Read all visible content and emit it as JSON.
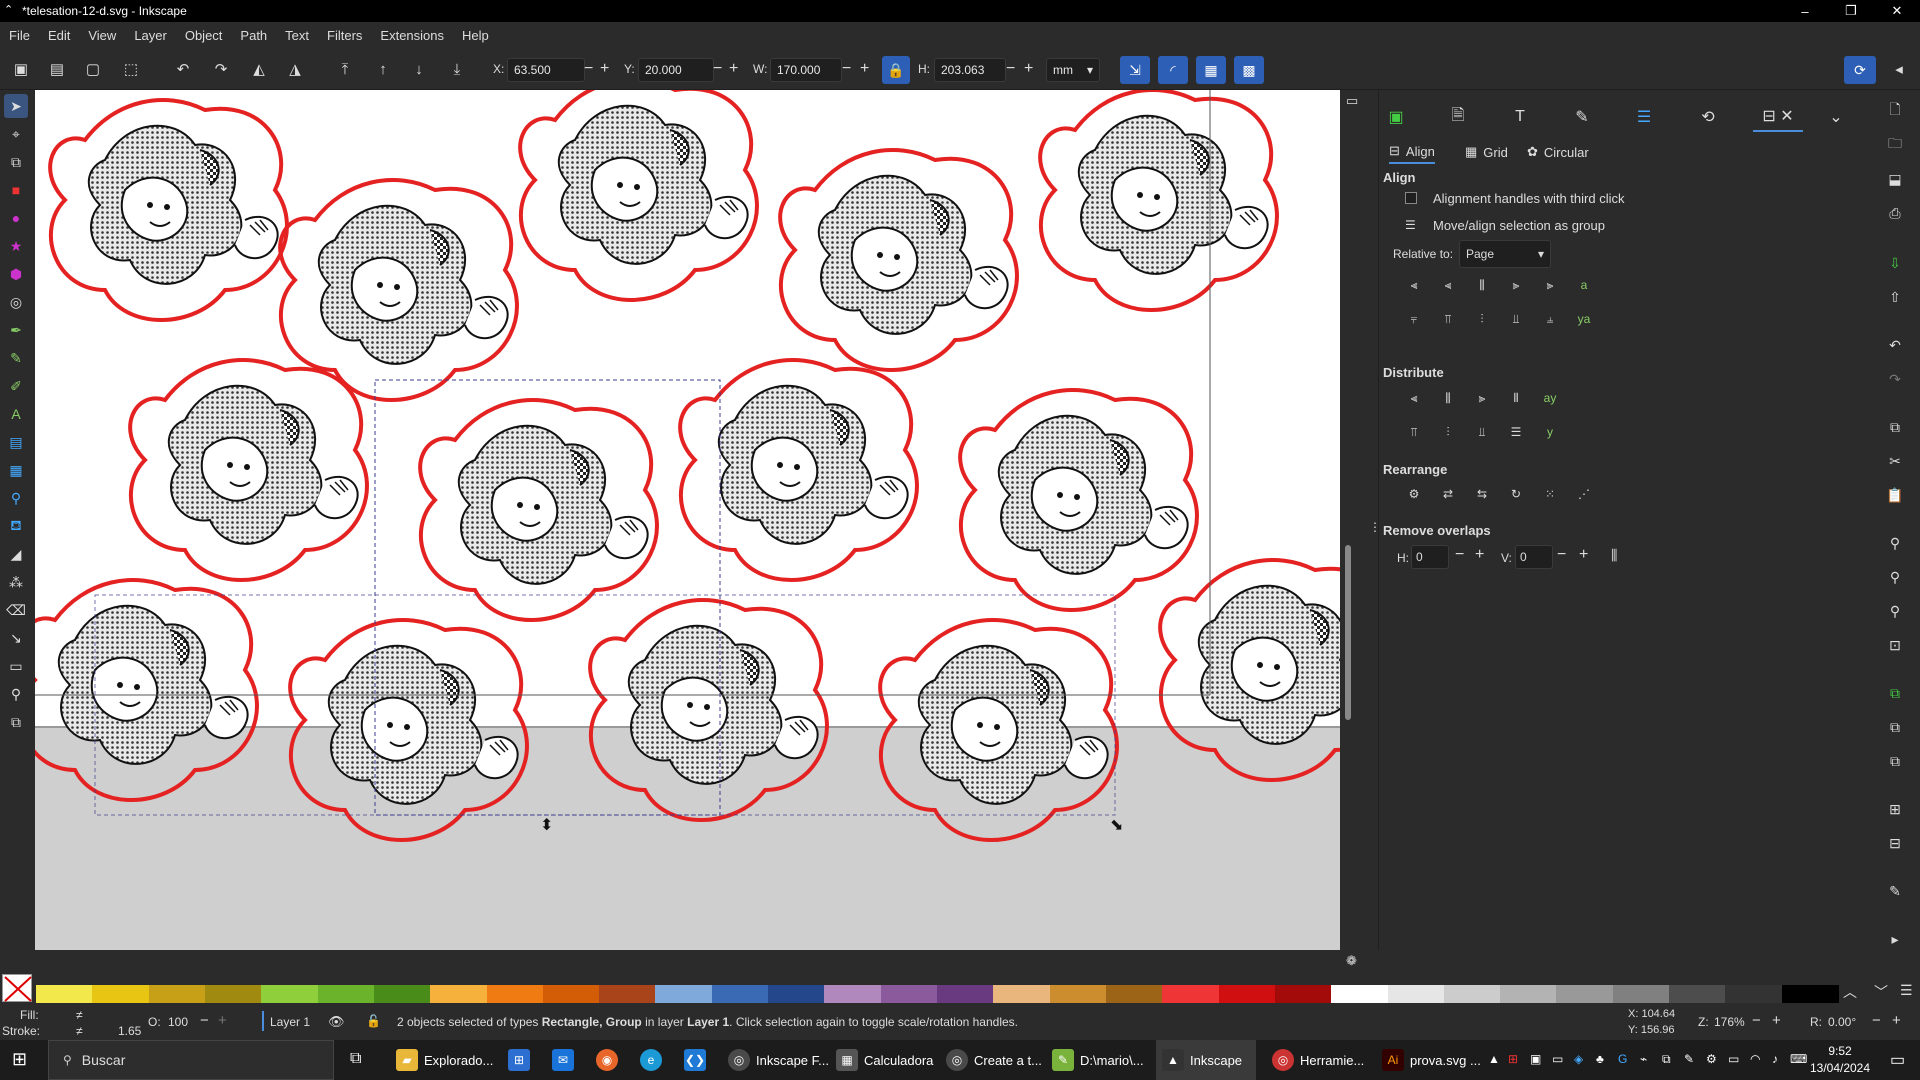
{
  "window": {
    "title": "*telesation-12-d.svg - Inkscape",
    "minimize": "–",
    "maximize": "❐",
    "close": "✕"
  },
  "menu": [
    "File",
    "Edit",
    "View",
    "Layer",
    "Object",
    "Path",
    "Text",
    "Filters",
    "Extensions",
    "Help"
  ],
  "toolbar": {
    "x_label": "X:",
    "x_value": "63.500",
    "y_label": "Y:",
    "y_value": "20.000",
    "w_label": "W:",
    "w_value": "170.000",
    "h_label": "H:",
    "h_value": "203.063",
    "unit": "mm"
  },
  "panel": {
    "subtabs": [
      "Align",
      "Grid",
      "Circular"
    ],
    "align_title": "Align",
    "opt_handles": "Alignment handles with third click",
    "opt_group": "Move/align selection as group",
    "relative_label": "Relative to:",
    "relative_value": "Page",
    "distribute_title": "Distribute",
    "rearrange_title": "Rearrange",
    "overlaps_title": "Remove overlaps",
    "h_label": "H:",
    "h_value": "0",
    "v_label": "V:",
    "v_value": "0"
  },
  "palette": {
    "colors": [
      "#f3e84b",
      "#e8c513",
      "#c7a017",
      "#a08a10",
      "#8fcf3c",
      "#6bb32a",
      "#4a8c1a",
      "#f6b13c",
      "#f07b13",
      "#d35c07",
      "#a8431a",
      "#7fa9db",
      "#3a6ab3",
      "#24478c",
      "#b088be",
      "#8a5a9c",
      "#6a3a80",
      "#e9b77d",
      "#cc8d2e",
      "#9b6416",
      "#ef3535",
      "#d01010",
      "#a30a0a",
      "#ffffff",
      "#e6e6e6",
      "#cccccc",
      "#b3b3b3",
      "#999999",
      "#808080",
      "#4d4d4d",
      "#333333",
      "#000000"
    ]
  },
  "status": {
    "fill_label": "Fill:",
    "fill_value": "≠",
    "stroke_label": "Stroke:",
    "stroke_value": "≠",
    "stroke_width": "1.65",
    "opacity_label": "O:",
    "opacity_value": "100",
    "layer": "Layer 1",
    "message_pre": "2 objects selected of types ",
    "message_types": "Rectangle, Group",
    "message_mid": " in layer ",
    "message_layer": "Layer 1",
    "message_post": ". Click selection again to toggle scale/rotation handles.",
    "cx": "X:  104.64",
    "cy": "Y:  156.96",
    "zoom_label": "Z:",
    "zoom_value": "176%",
    "rot_label": "R:",
    "rot_value": "0.00°"
  },
  "taskbar": {
    "search": "Buscar",
    "apps": [
      "Explorado...",
      "Inkscape F...",
      "Calculadora",
      "Create a t...",
      "D:\\mario\\...",
      "Inkscape",
      "Herramie...",
      "prova.svg ..."
    ],
    "time": "9:52",
    "date": "13/04/2024"
  }
}
